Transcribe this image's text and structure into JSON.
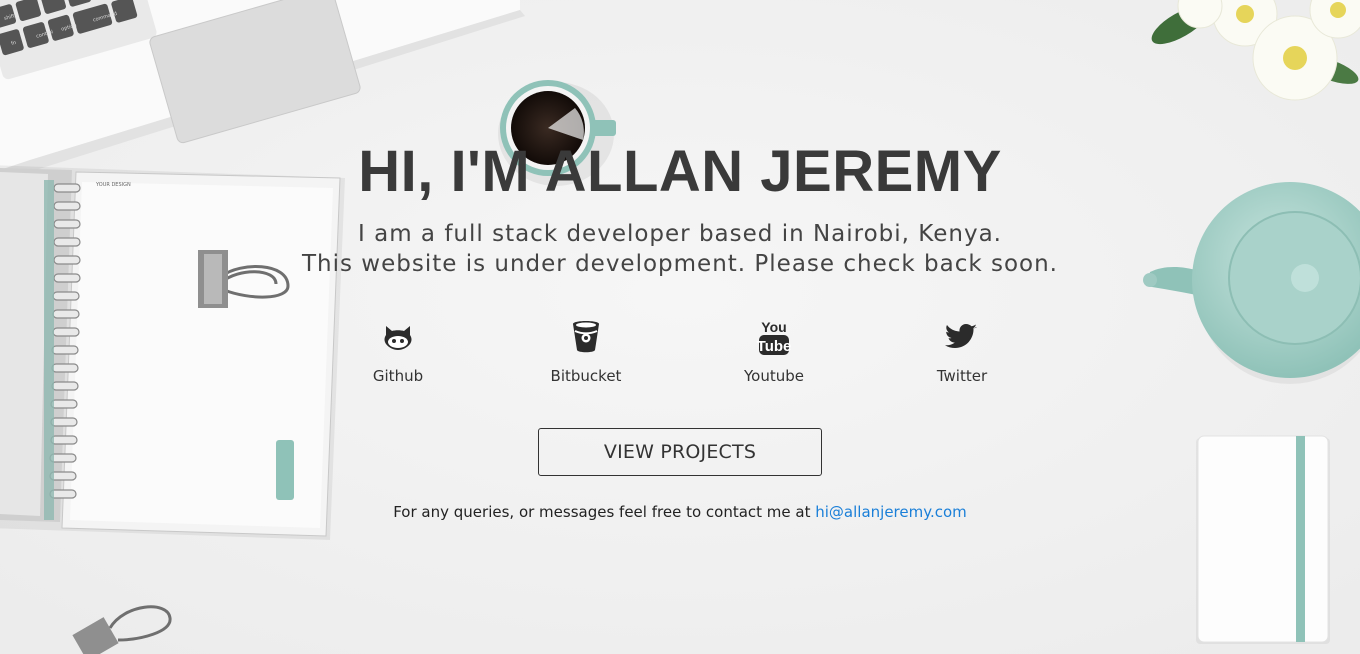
{
  "hero": {
    "title": "HI, I'M ALLAN JEREMY",
    "subtitle_line1": "I am a full stack developer based in Nairobi, Kenya.",
    "subtitle_line2": "This website is under development. Please check back soon."
  },
  "social": [
    {
      "label": "Github",
      "icon": "github-icon"
    },
    {
      "label": "Bitbucket",
      "icon": "bitbucket-icon"
    },
    {
      "label": "Youtube",
      "icon": "youtube-icon"
    },
    {
      "label": "Twitter",
      "icon": "twitter-icon"
    }
  ],
  "cta": {
    "label": "VIEW PROJECTS"
  },
  "contact": {
    "text": "For any queries, or messages feel free to contact me at ",
    "email": "hi@allanjeremy.com"
  },
  "colors": {
    "background": "#f0f0f0",
    "text": "#333333",
    "link": "#1a7fd8",
    "accent_mint": "#9cc9c0"
  },
  "laptop_keys": {
    "row1": [
      "shift",
      "",
      "",
      "",
      ""
    ],
    "row2": [
      "fn",
      "control",
      "option",
      "command",
      ""
    ]
  },
  "notebook_brand": "YOUR DESIGN"
}
